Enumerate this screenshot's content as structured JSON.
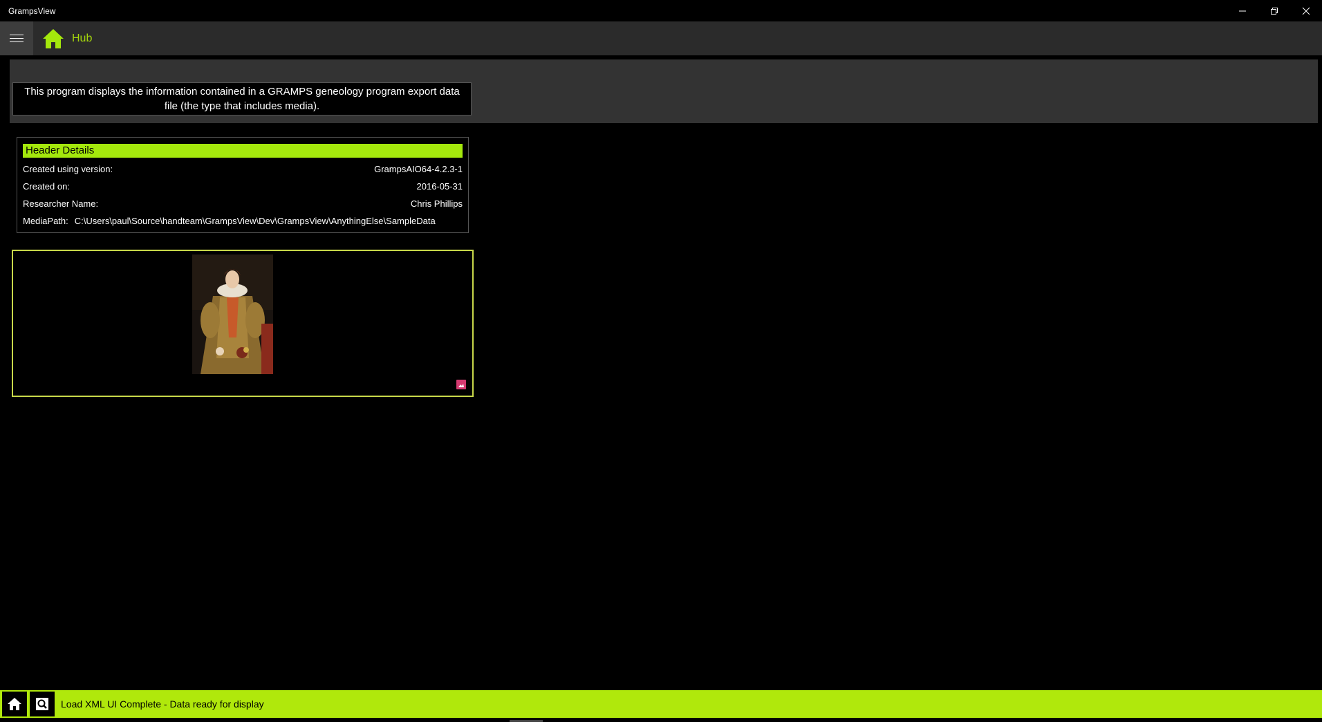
{
  "window": {
    "title": "GrampsView",
    "minimize_icon": "minimize-icon",
    "restore_icon": "restore-icon",
    "close_icon": "close-icon"
  },
  "appbar": {
    "menu_icon": "hamburger-icon",
    "hub_icon": "home-icon",
    "hub_label": "Hub",
    "accent_color": "#a4d60c"
  },
  "banner": {
    "text": "This program displays the information contained in a GRAMPS geneology program export data file (the type that includes media)."
  },
  "header_details": {
    "title": "Header Details",
    "rows": [
      {
        "label": "Created using version:",
        "value": "GrampsAIO64-4.2.3-1"
      },
      {
        "label": "Created on:",
        "value": "2016-05-31"
      },
      {
        "label": "Researcher Name:",
        "value": "Chris Phillips"
      },
      {
        "label": "MediaPath:",
        "value": "C:\\Users\\paul\\Source\\handteam\\GrampsView\\Dev\\GrampsView\\AnythingElse\\SampleData"
      }
    ]
  },
  "media_card": {
    "image": "portrait-image",
    "badge_icon": "image-icon",
    "badge_color": "#d43a70"
  },
  "statusbar": {
    "home_icon": "home-icon",
    "search_icon": "search-icon",
    "message": "Load XML UI Complete - Data ready for display",
    "background_color": "#b0e80c"
  }
}
